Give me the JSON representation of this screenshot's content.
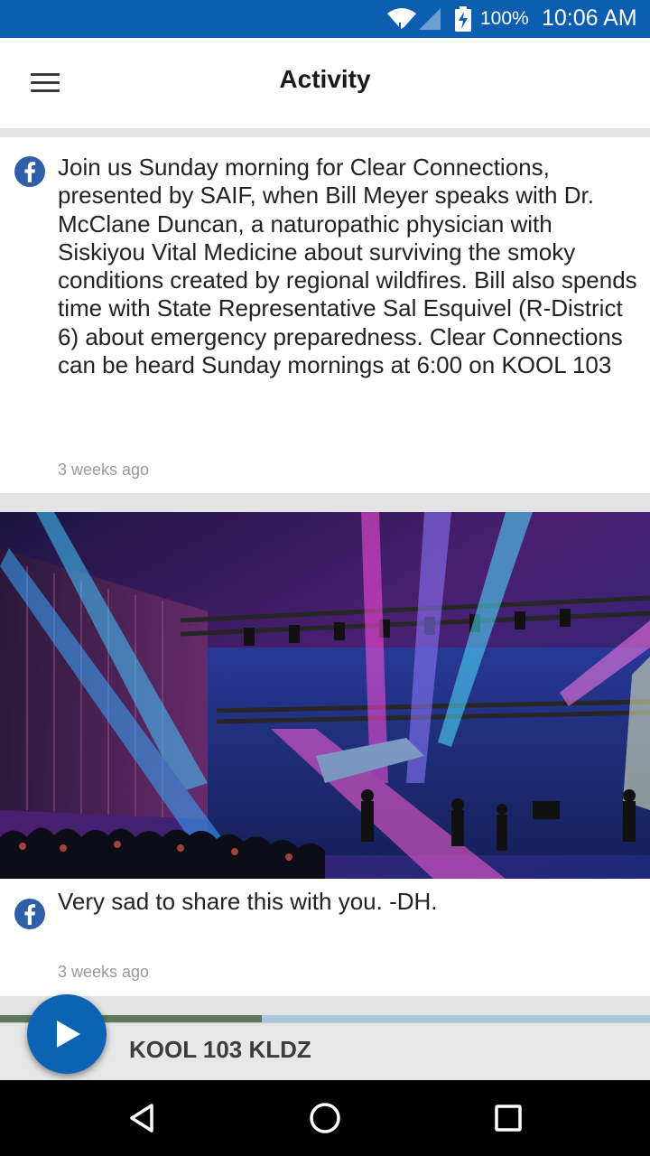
{
  "status_bar": {
    "battery_percent": "100%",
    "time": "10:06 AM",
    "color": "#0c5fb0"
  },
  "app_bar": {
    "title": "Activity",
    "menu_icon": "hamburger-menu-icon"
  },
  "feed": {
    "posts": [
      {
        "source_icon": "facebook-icon",
        "text": "Join us Sunday morning for Clear Connections, presented by SAIF, when Bill Meyer speaks with Dr. McClane Duncan, a naturopathic physician with Siskiyou Vital Medicine about surviving the smoky conditions created by regional wildfires. Bill also spends time with State Representative Sal Esquivel (R-District 6) about emergency preparedness. Clear Connections can be heard Sunday mornings at 6:00 on KOOL 103",
        "timestamp": "3 weeks ago"
      },
      {
        "source_icon": "facebook-icon",
        "image": "concert-stage-photo",
        "text": "Very sad to share this with you.  -DH.",
        "timestamp": "3 weeks ago"
      }
    ]
  },
  "player": {
    "station_name": "KOOL 103 KLDZ",
    "play_icon": "play-icon",
    "accent_color": "#0c62b3"
  },
  "nav_bar": {
    "back_icon": "back-icon",
    "home_icon": "home-icon",
    "recents_icon": "recents-icon"
  }
}
